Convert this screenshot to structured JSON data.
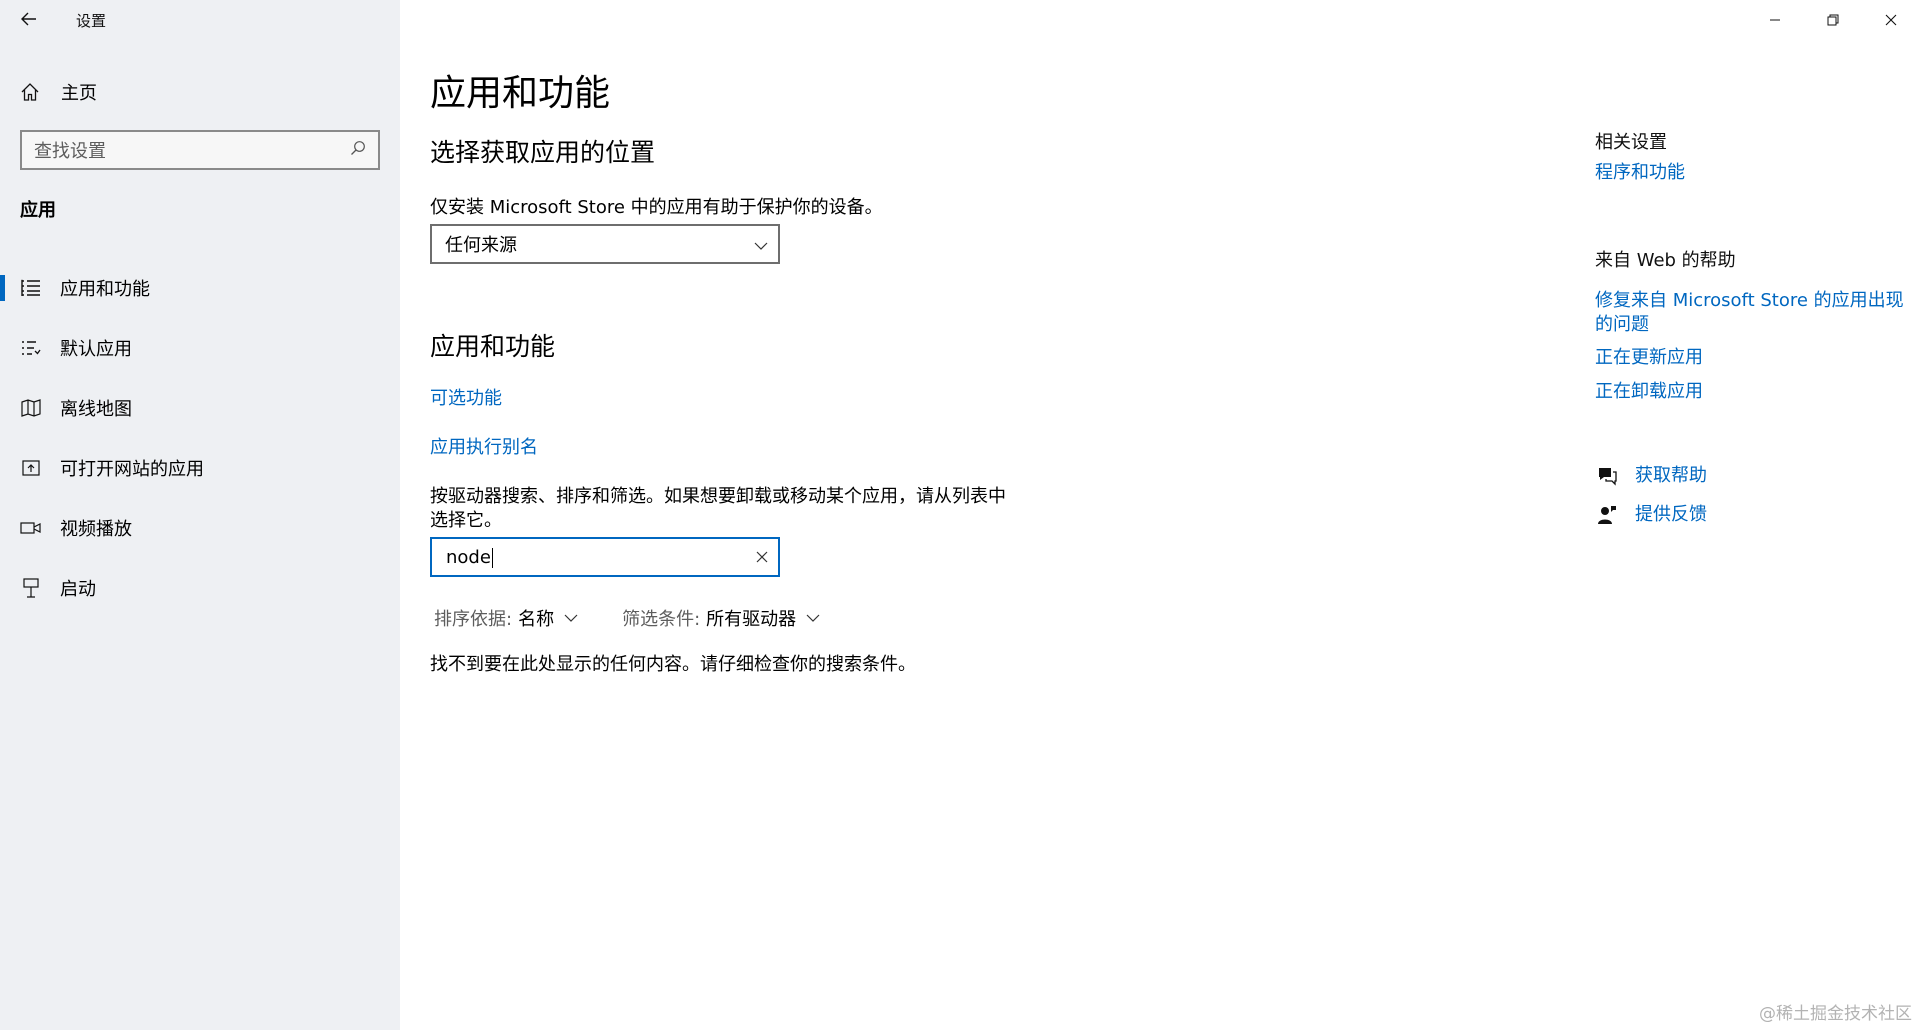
{
  "window": {
    "title": "设置"
  },
  "sidebar": {
    "home_label": "主页",
    "search_placeholder": "查找设置",
    "section_title": "应用",
    "items": [
      {
        "label": "应用和功能",
        "icon": "apps-list-icon",
        "active": true
      },
      {
        "label": "默认应用",
        "icon": "default-apps-icon",
        "active": false
      },
      {
        "label": "离线地图",
        "icon": "offline-maps-icon",
        "active": false
      },
      {
        "label": "可打开网站的应用",
        "icon": "apps-for-websites-icon",
        "active": false
      },
      {
        "label": "视频播放",
        "icon": "video-playback-icon",
        "active": false
      },
      {
        "label": "启动",
        "icon": "startup-icon",
        "active": false
      }
    ]
  },
  "main": {
    "title": "应用和功能",
    "choose_location_heading": "选择获取应用的位置",
    "store_notice": "仅安装 Microsoft Store 中的应用有助于保护你的设备。",
    "source_dropdown_value": "任何来源",
    "apps_heading": "应用和功能",
    "optional_features_link": "可选功能",
    "app_alias_link": "应用执行别名",
    "search_instructions_line1": "按驱动器搜索、排序和筛选。如果想要卸载或移动某个应用，请从列表中",
    "search_instructions_line2": "选择它。",
    "search_value": "node",
    "sort_label": "排序依据:",
    "sort_value": "名称",
    "filter_label": "筛选条件:",
    "filter_value": "所有驱动器",
    "no_results": "找不到要在此处显示的任何内容。请仔细检查你的搜索条件。"
  },
  "related": {
    "related_settings_heading": "相关设置",
    "programs_features_link": "程序和功能",
    "web_help_heading": "来自 Web 的帮助",
    "repair_store_link_line1": "修复来自 Microsoft Store 的应用出现",
    "repair_store_link_line2": "的问题",
    "updating_apps_link": "正在更新应用",
    "uninstalling_apps_link": "正在卸载应用",
    "get_help_link": "获取帮助",
    "feedback_link": "提供反馈"
  },
  "watermark": "@稀土掘金技术社区",
  "colors": {
    "accent": "#0067c0",
    "sidebar_bg": "#eef0f3"
  }
}
